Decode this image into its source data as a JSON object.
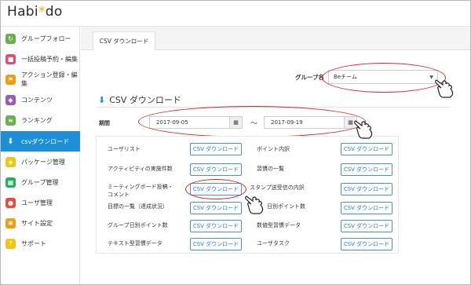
{
  "app": {
    "logo_main": "Habi",
    "logo_dot": "*",
    "logo_end": "do"
  },
  "sidebar": {
    "items": [
      {
        "label": "グループフォロー",
        "icon": "follow-icon",
        "color": "#6ab04c"
      },
      {
        "label": "一括投稿予約・編集",
        "icon": "chat-icon",
        "color": "#e74c6c"
      },
      {
        "label": "アクション登録・編集",
        "icon": "flag-icon",
        "color": "#f39c12"
      },
      {
        "label": "コンテンツ",
        "icon": "cube-icon",
        "color": "#9b59b6"
      },
      {
        "label": "ランキング",
        "icon": "ranking-icon",
        "color": "#6ab04c"
      },
      {
        "label": "csvダウンロード",
        "icon": "download-icon",
        "color": "#1e8fd6"
      },
      {
        "label": "パッケージ管理",
        "icon": "layers-icon",
        "color": "#f1c40f"
      },
      {
        "label": "グループ管理",
        "icon": "group-icon",
        "color": "#27ae60"
      },
      {
        "label": "ユーザ管理",
        "icon": "users-icon",
        "color": "#e74c3c"
      },
      {
        "label": "サイト設定",
        "icon": "gear-icon",
        "color": "#f39c12"
      },
      {
        "label": "サポート",
        "icon": "help-icon",
        "color": "#f1c40f"
      }
    ]
  },
  "tabbar": {
    "tab_label": "CSV ダウンロード"
  },
  "group": {
    "label": "グループ名",
    "selected": "Beチーム"
  },
  "section": {
    "title": "CSV ダウンロード"
  },
  "period": {
    "label": "期間",
    "start": "2017-09-05",
    "end": "2017-09-19",
    "separator": "～"
  },
  "downloads": {
    "button_label": "CSV ダウンロード",
    "left": [
      "ユーザリスト",
      "アクティビティの実施件数",
      "ミーティングボード投稿・コメント",
      "目標の一覧（達成状況）",
      "グループ日別ポイント数",
      "テキスト型習慣データ"
    ],
    "right": [
      "ポイント内訳",
      "習慣の一覧",
      "スタンプ送受信の内訳",
      "日別ポイント数",
      "数値型習慣データ",
      "ユーザタスク"
    ]
  },
  "colors": {
    "accent": "#1e8fd6",
    "highlight": "#d9262b"
  }
}
